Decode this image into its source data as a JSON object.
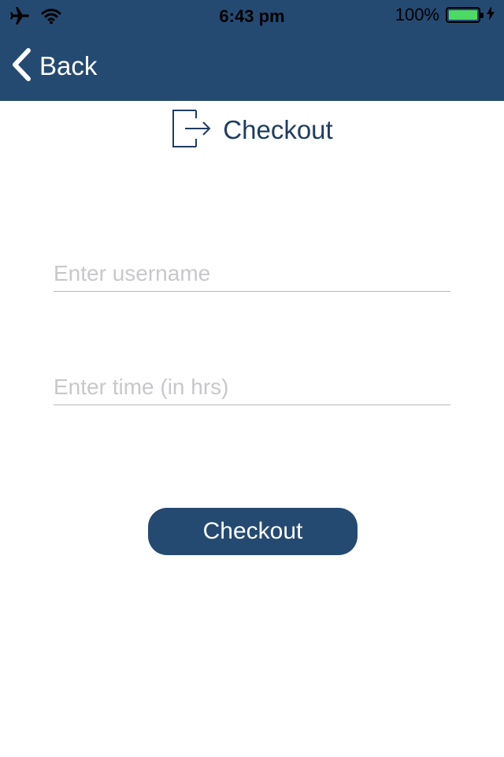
{
  "status_bar": {
    "time": "6:43 pm",
    "battery_percent": "100%",
    "battery_level": 1.0,
    "icons": [
      "airplane-icon",
      "wifi-icon",
      "battery-icon",
      "charging-bolt-icon"
    ]
  },
  "nav": {
    "back_label": "Back",
    "back_icon": "chevron-left-icon"
  },
  "page": {
    "title": "Checkout",
    "title_icon": "logout-icon"
  },
  "form": {
    "username_placeholder": "Enter username",
    "username_value": "",
    "time_placeholder": "Enter time (in hrs)",
    "time_value": "",
    "submit_label": "Checkout"
  },
  "colors": {
    "header_bg": "#254a72",
    "title_text": "#1f3d63",
    "button_bg": "#254a72",
    "battery_fill": "#4cd964"
  }
}
